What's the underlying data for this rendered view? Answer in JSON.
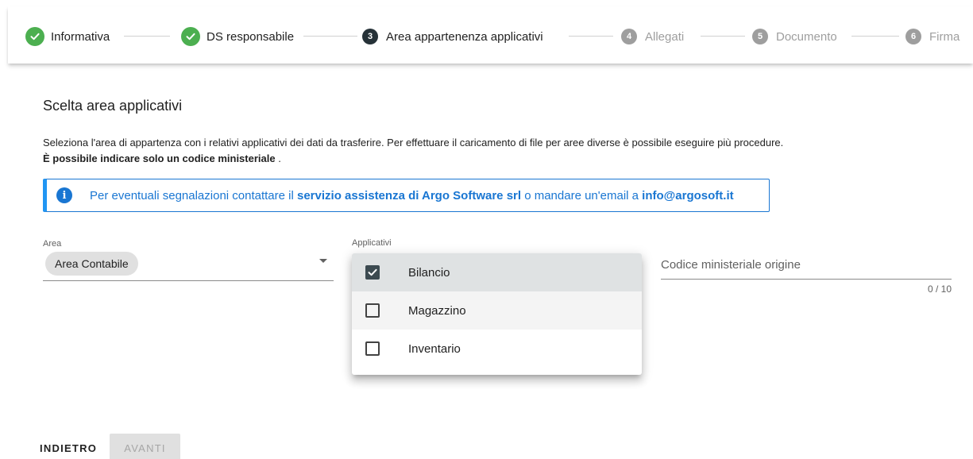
{
  "stepper": {
    "steps": [
      {
        "label": "Informativa",
        "state": "done"
      },
      {
        "label": "DS responsabile",
        "state": "done"
      },
      {
        "label": "Area appartenenza applicativi",
        "state": "active",
        "number": "3"
      },
      {
        "label": "Allegati",
        "state": "pending",
        "number": "4"
      },
      {
        "label": "Documento",
        "state": "pending",
        "number": "5"
      },
      {
        "label": "Firma",
        "state": "pending",
        "number": "6"
      }
    ]
  },
  "main": {
    "title": "Scelta area applicativi",
    "description": "Seleziona l'area di appartenza con i relativi applicativi dei dati da trasferire. Per effettuare il caricamento di file per aree diverse è possibile eseguire più procedure.",
    "note_bold": "È possibile indicare solo un codice ministeriale",
    "note_tail": " ."
  },
  "alert": {
    "text_before": "Per eventuali segnalazioni contattare il ",
    "link_service": "servizio assistenza di Argo Software srl",
    "text_middle": " o mandare un'email a ",
    "email": "info@argosoft.it"
  },
  "form": {
    "area_label": "Area",
    "area_value": "Area Contabile",
    "applicativi_label": "Applicativi",
    "codice_placeholder": "Codice ministeriale origine",
    "codice_counter": "0 / 10"
  },
  "menu": {
    "options": [
      {
        "label": "Bilancio",
        "checked": true
      },
      {
        "label": "Magazzino",
        "checked": false
      },
      {
        "label": "Inventario",
        "checked": false
      }
    ]
  },
  "buttons": {
    "back": "INDIETRO",
    "next": "AVANTI"
  },
  "colors": {
    "done": "#4caf50",
    "active": "#263238",
    "pending": "#9e9e9e",
    "info": "#1976d2"
  }
}
